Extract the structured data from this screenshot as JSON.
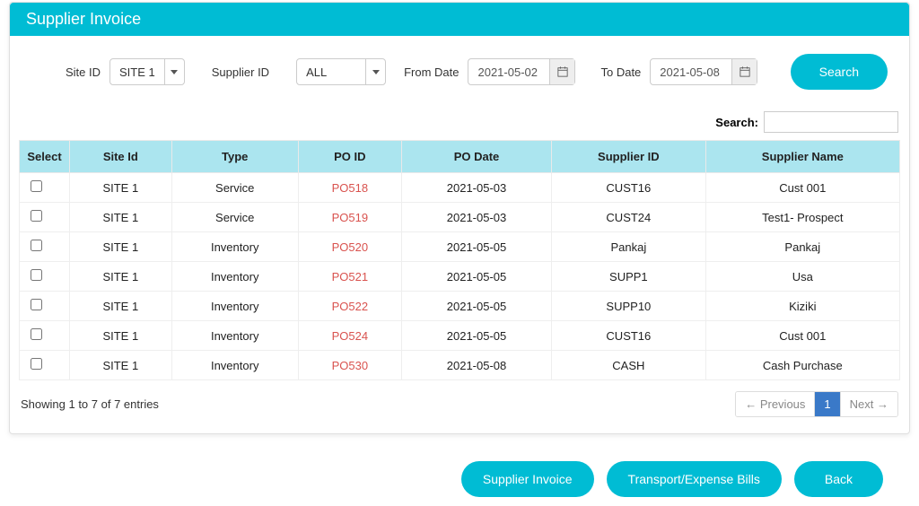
{
  "header": {
    "title": "Supplier Invoice"
  },
  "filters": {
    "site_id_label": "Site ID",
    "site_id_value": "SITE 1",
    "supplier_id_label": "Supplier ID",
    "supplier_id_value": "ALL",
    "from_date_label": "From Date",
    "from_date_value": "2021-05-02",
    "to_date_label": "To Date",
    "to_date_value": "2021-05-08",
    "search_button": "Search"
  },
  "table_search": {
    "label": "Search:",
    "value": ""
  },
  "table": {
    "headers": {
      "select": "Select",
      "site_id": "Site Id",
      "type": "Type",
      "po_id": "PO ID",
      "po_date": "PO Date",
      "supplier_id": "Supplier ID",
      "supplier_name": "Supplier Name"
    },
    "rows": [
      {
        "site_id": "SITE 1",
        "type": "Service",
        "po_id": "PO518",
        "po_date": "2021-05-03",
        "supplier_id": "CUST16",
        "supplier_name": "Cust 001"
      },
      {
        "site_id": "SITE 1",
        "type": "Service",
        "po_id": "PO519",
        "po_date": "2021-05-03",
        "supplier_id": "CUST24",
        "supplier_name": "Test1- Prospect"
      },
      {
        "site_id": "SITE 1",
        "type": "Inventory",
        "po_id": "PO520",
        "po_date": "2021-05-05",
        "supplier_id": "Pankaj",
        "supplier_name": "Pankaj"
      },
      {
        "site_id": "SITE 1",
        "type": "Inventory",
        "po_id": "PO521",
        "po_date": "2021-05-05",
        "supplier_id": "SUPP1",
        "supplier_name": "Usa"
      },
      {
        "site_id": "SITE 1",
        "type": "Inventory",
        "po_id": "PO522",
        "po_date": "2021-05-05",
        "supplier_id": "SUPP10",
        "supplier_name": "Kiziki"
      },
      {
        "site_id": "SITE 1",
        "type": "Inventory",
        "po_id": "PO524",
        "po_date": "2021-05-05",
        "supplier_id": "CUST16",
        "supplier_name": "Cust 001"
      },
      {
        "site_id": "SITE 1",
        "type": "Inventory",
        "po_id": "PO530",
        "po_date": "2021-05-08",
        "supplier_id": "CASH",
        "supplier_name": "Cash Purchase"
      }
    ]
  },
  "table_info": "Showing 1 to 7 of 7 entries",
  "pager": {
    "previous": "← Previous",
    "page": "1",
    "next": "Next →"
  },
  "actions": {
    "supplier_invoice": "Supplier Invoice",
    "transport_expense": "Transport/Expense Bills",
    "back": "Back"
  }
}
